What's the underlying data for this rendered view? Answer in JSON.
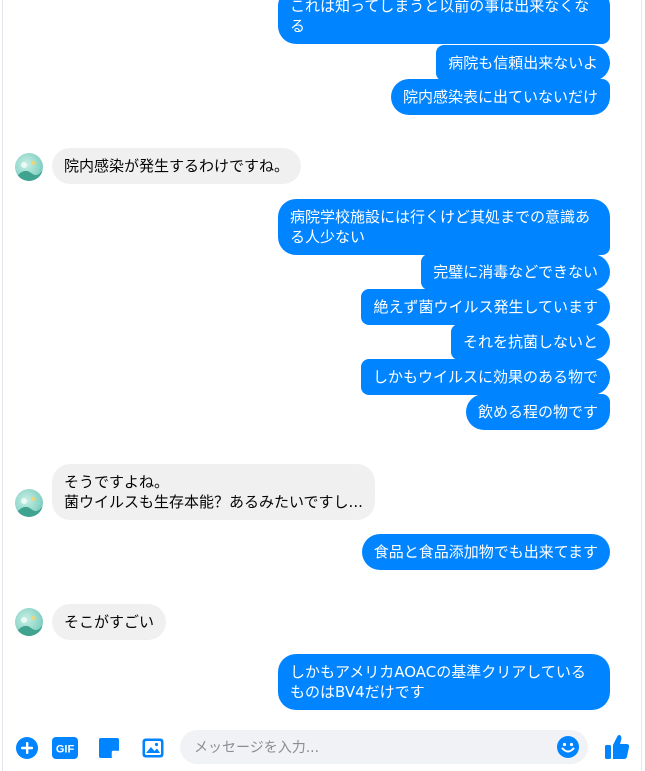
{
  "colors": {
    "outgoing_bubble": "#0084ff",
    "incoming_bubble": "#f0f0f0",
    "accent": "#0084ff"
  },
  "messages": {
    "m1": "これは知ってしまうと以前の事は出来なくなる",
    "m2": "病院も信頼出来ないよ",
    "m3": "院内感染表に出ていないだけ",
    "m4": "院内感染が発生するわけですね。",
    "m5": "病院学校施設には行くけど其処までの意識ある人少ない",
    "m6": "完璧に消毒などできない",
    "m7": "絶えず菌ウイルス発生しています",
    "m8": "それを抗菌しないと",
    "m9": "しかもウイルスに効果のある物で",
    "m10": "飲める程の物です",
    "m11_line1": "そうですよね。",
    "m11_line2": "菌ウイルスも生存本能？あるみたいですし...",
    "m12": "食品と食品添加物でも出来てます",
    "m13": "そこがすごい",
    "m14": "しかもアメリカAOACの基準クリアしているものはBV4だけです"
  },
  "composer": {
    "placeholder": "メッセージを入力...",
    "gif_label": "GIF",
    "icons": [
      "plus-icon",
      "gif-icon",
      "sticker-icon",
      "image-icon",
      "emoji-icon",
      "thumbs-up-icon"
    ]
  }
}
